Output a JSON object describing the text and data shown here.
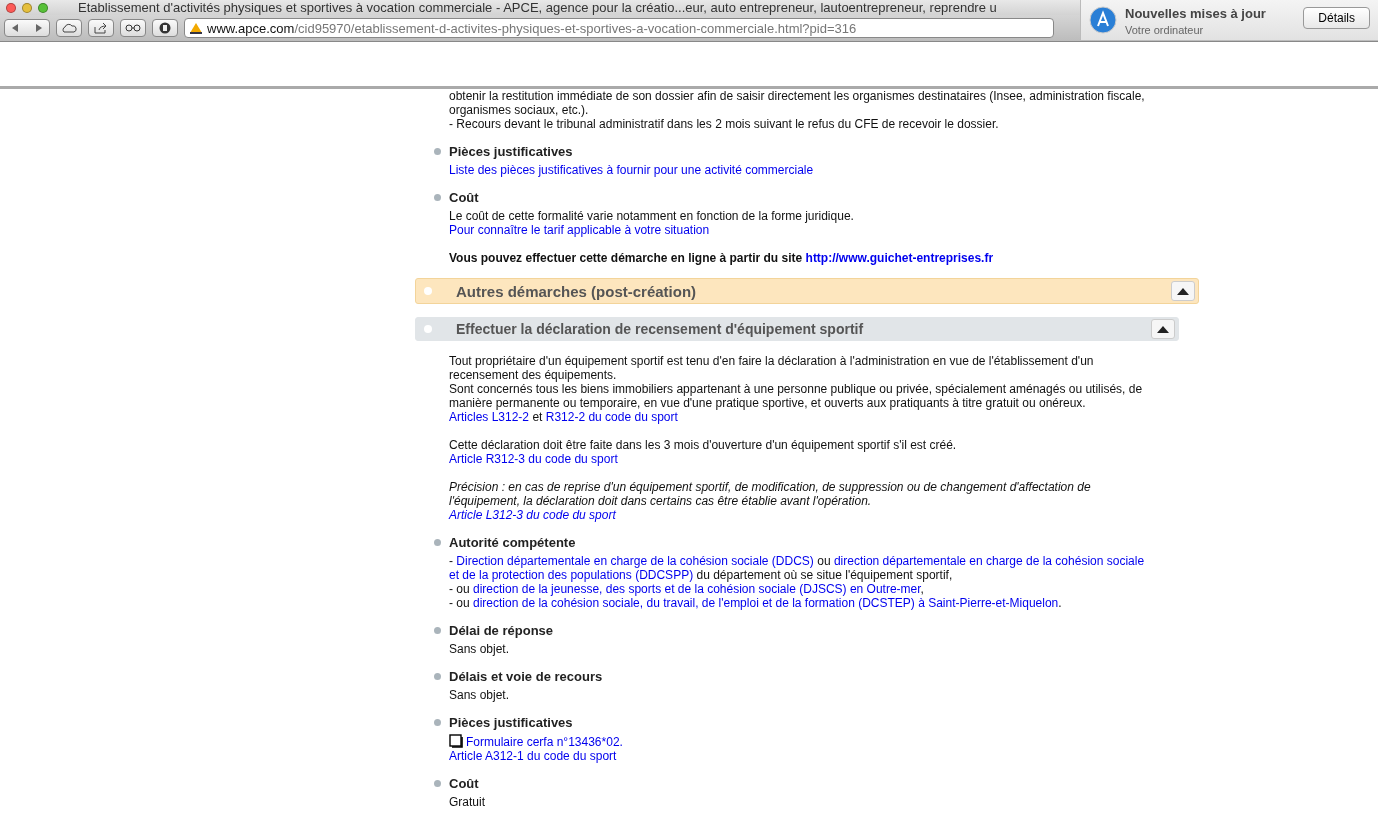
{
  "browser": {
    "title": "Etablissement d'activités physiques et sportives à vocation commerciale - APCE, agence pour la créatio...eur, auto entrepreneur, lautoentrepreneur, reprendre u",
    "url_domain": "www.apce.com",
    "url_path": "/cid95970/etablissement-d-activites-physiques-et-sportives-a-vocation-commerciale.html?pid=316"
  },
  "notification": {
    "title": "Nouvelles mises à jour",
    "subtitle": "Votre ordinateur",
    "button": "Détails"
  },
  "blocks": [
    {
      "kind": "text",
      "paragraphs": [
        {
          "kind": "plain",
          "lines": [
            [
              {
                "kind": "text",
                "text": "obtenir la restitution immédiate de son dossier afin de saisir directement les organismes destinataires (Insee, administration fiscale,"
              }
            ],
            [
              {
                "kind": "text",
                "text": "organismes sociaux, etc.)."
              }
            ],
            [
              {
                "kind": "text",
                "text": "- Recours devant le tribunal administratif dans les 2 mois suivant le refus du CFE de recevoir le dossier."
              }
            ]
          ]
        }
      ]
    },
    {
      "kind": "bullet",
      "title": "Pièces justificatives",
      "paragraphs": [
        {
          "kind": "plain",
          "lines": [
            [
              {
                "kind": "link",
                "text": "Liste des pièces justificatives à fournir pour une activité commerciale"
              }
            ]
          ]
        }
      ]
    },
    {
      "kind": "bullet",
      "title": "Coût",
      "paragraphs": [
        {
          "kind": "plain",
          "lines": [
            [
              {
                "kind": "text",
                "text": "Le coût de cette formalité varie notamment en fonction de la forme juridique."
              }
            ],
            [
              {
                "kind": "link",
                "text": "Pour connaître le tarif applicable à votre situation"
              }
            ]
          ]
        },
        {
          "kind": "bold",
          "lines": [
            [
              {
                "kind": "text",
                "text": "Vous pouvez effectuer cette démarche en ligne à partir du site "
              },
              {
                "kind": "link",
                "text": "http://www.guichet-entreprises.fr"
              }
            ]
          ]
        }
      ]
    },
    {
      "kind": "main-header",
      "title": "Autres démarches (post-création)",
      "expanded": true
    },
    {
      "kind": "sub-header",
      "title": "Effectuer la déclaration de recensement d'équipement sportif",
      "expanded": true
    },
    {
      "kind": "text",
      "paragraphs": [
        {
          "kind": "plain",
          "lines": [
            [
              {
                "kind": "text",
                "text": "Tout propriétaire d'un équipement sportif est tenu d'en faire la déclaration à l'administration en vue de l'établissement d'un"
              }
            ],
            [
              {
                "kind": "text",
                "text": "recensement des équipements."
              }
            ],
            [
              {
                "kind": "text",
                "text": "Sont concernés tous les biens immobiliers appartenant à une personne publique ou privée, spécialement aménagés ou utilisés, de"
              }
            ],
            [
              {
                "kind": "text",
                "text": "manière permanente ou temporaire, en vue d'une pratique sportive, et ouverts aux pratiquants à titre gratuit ou onéreux."
              }
            ],
            [
              {
                "kind": "link",
                "text": "Articles L312-2"
              },
              {
                "kind": "text",
                "text": " et "
              },
              {
                "kind": "link",
                "text": "R312-2 du code du sport"
              }
            ]
          ]
        },
        {
          "kind": "plain",
          "lines": [
            [
              {
                "kind": "text",
                "text": "Cette déclaration doit être faite dans les 3 mois d'ouverture d'un équipement sportif s'il est créé."
              }
            ],
            [
              {
                "kind": "link",
                "text": "Article R312-3 du code du sport"
              }
            ]
          ]
        },
        {
          "kind": "italic",
          "lines": [
            [
              {
                "kind": "text",
                "text": "Précision : en cas de reprise d'un équipement sportif, de modification, de suppression ou de changement d'affectation de"
              }
            ],
            [
              {
                "kind": "text",
                "text": "l'équipement, la déclaration doit dans certains cas être établie avant l'opération."
              }
            ],
            [
              {
                "kind": "link",
                "text": "Article L312-3 du code du sport"
              }
            ]
          ]
        }
      ]
    },
    {
      "kind": "bullet",
      "title": "Autorité compétente",
      "paragraphs": [
        {
          "kind": "plain",
          "lines": [
            [
              {
                "kind": "text",
                "text": "- "
              },
              {
                "kind": "link",
                "text": "Direction départementale en charge de la cohésion sociale (DDCS)"
              },
              {
                "kind": "text",
                "text": " ou "
              },
              {
                "kind": "link",
                "text": "direction départementale en charge de la cohésion sociale"
              }
            ],
            [
              {
                "kind": "link",
                "text": "et de la protection des populations (DDCSPP)"
              },
              {
                "kind": "text",
                "text": " du département où se situe l'équipement sportif,"
              }
            ],
            [
              {
                "kind": "text",
                "text": "- ou "
              },
              {
                "kind": "link",
                "text": "direction de la jeunesse, des sports et de la cohésion sociale (DJSCS) en Outre-mer"
              },
              {
                "kind": "text",
                "text": ","
              }
            ],
            [
              {
                "kind": "text",
                "text": "- ou "
              },
              {
                "kind": "link",
                "text": "direction de la cohésion sociale, du travail, de l'emploi et de la formation (DCSTEP) à Saint-Pierre-et-Miquelon"
              },
              {
                "kind": "text",
                "text": "."
              }
            ]
          ]
        }
      ]
    },
    {
      "kind": "bullet",
      "title": "Délai de réponse",
      "paragraphs": [
        {
          "kind": "plain",
          "lines": [
            [
              {
                "kind": "text",
                "text": "Sans objet."
              }
            ]
          ]
        }
      ]
    },
    {
      "kind": "bullet",
      "title": "Délais et voie de recours",
      "paragraphs": [
        {
          "kind": "plain",
          "lines": [
            [
              {
                "kind": "text",
                "text": "Sans objet."
              }
            ]
          ]
        }
      ]
    },
    {
      "kind": "bullet",
      "title": "Pièces justificatives",
      "paragraphs": [
        {
          "kind": "plain",
          "lines": [
            [
              {
                "kind": "document-link",
                "text": "Formulaire cerfa n°13436*02."
              }
            ],
            [
              {
                "kind": "link",
                "text": "Article A312-1 du code du sport"
              }
            ]
          ]
        }
      ]
    },
    {
      "kind": "bullet",
      "title": "Coût",
      "paragraphs": [
        {
          "kind": "plain",
          "lines": [
            [
              {
                "kind": "text",
                "text": "Gratuit"
              }
            ]
          ]
        }
      ]
    }
  ]
}
